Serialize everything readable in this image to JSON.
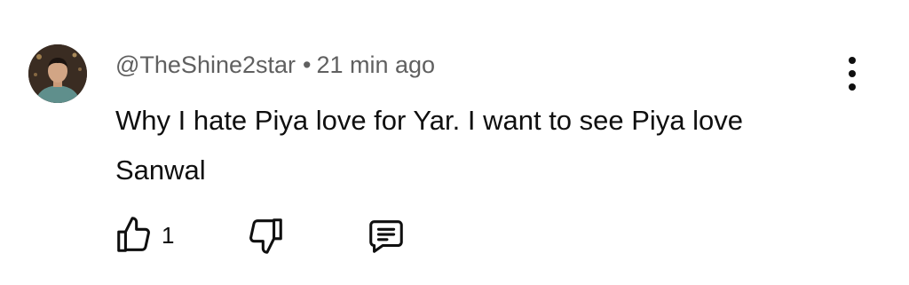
{
  "comment": {
    "author": "@TheShine2star",
    "separator": "•",
    "time": "21 min ago",
    "text": "Why I hate Piya love for Yar. I want to see Piya love Sanwal",
    "like_count": "1"
  },
  "icons": {
    "avatar": "avatar-photo",
    "more": "more-vert-icon",
    "like": "thumb-up-icon",
    "dislike": "thumb-down-icon",
    "reply": "comment-icon"
  },
  "colors": {
    "primary_text": "#0f0f0f",
    "secondary_text": "#606060",
    "background": "#ffffff"
  }
}
